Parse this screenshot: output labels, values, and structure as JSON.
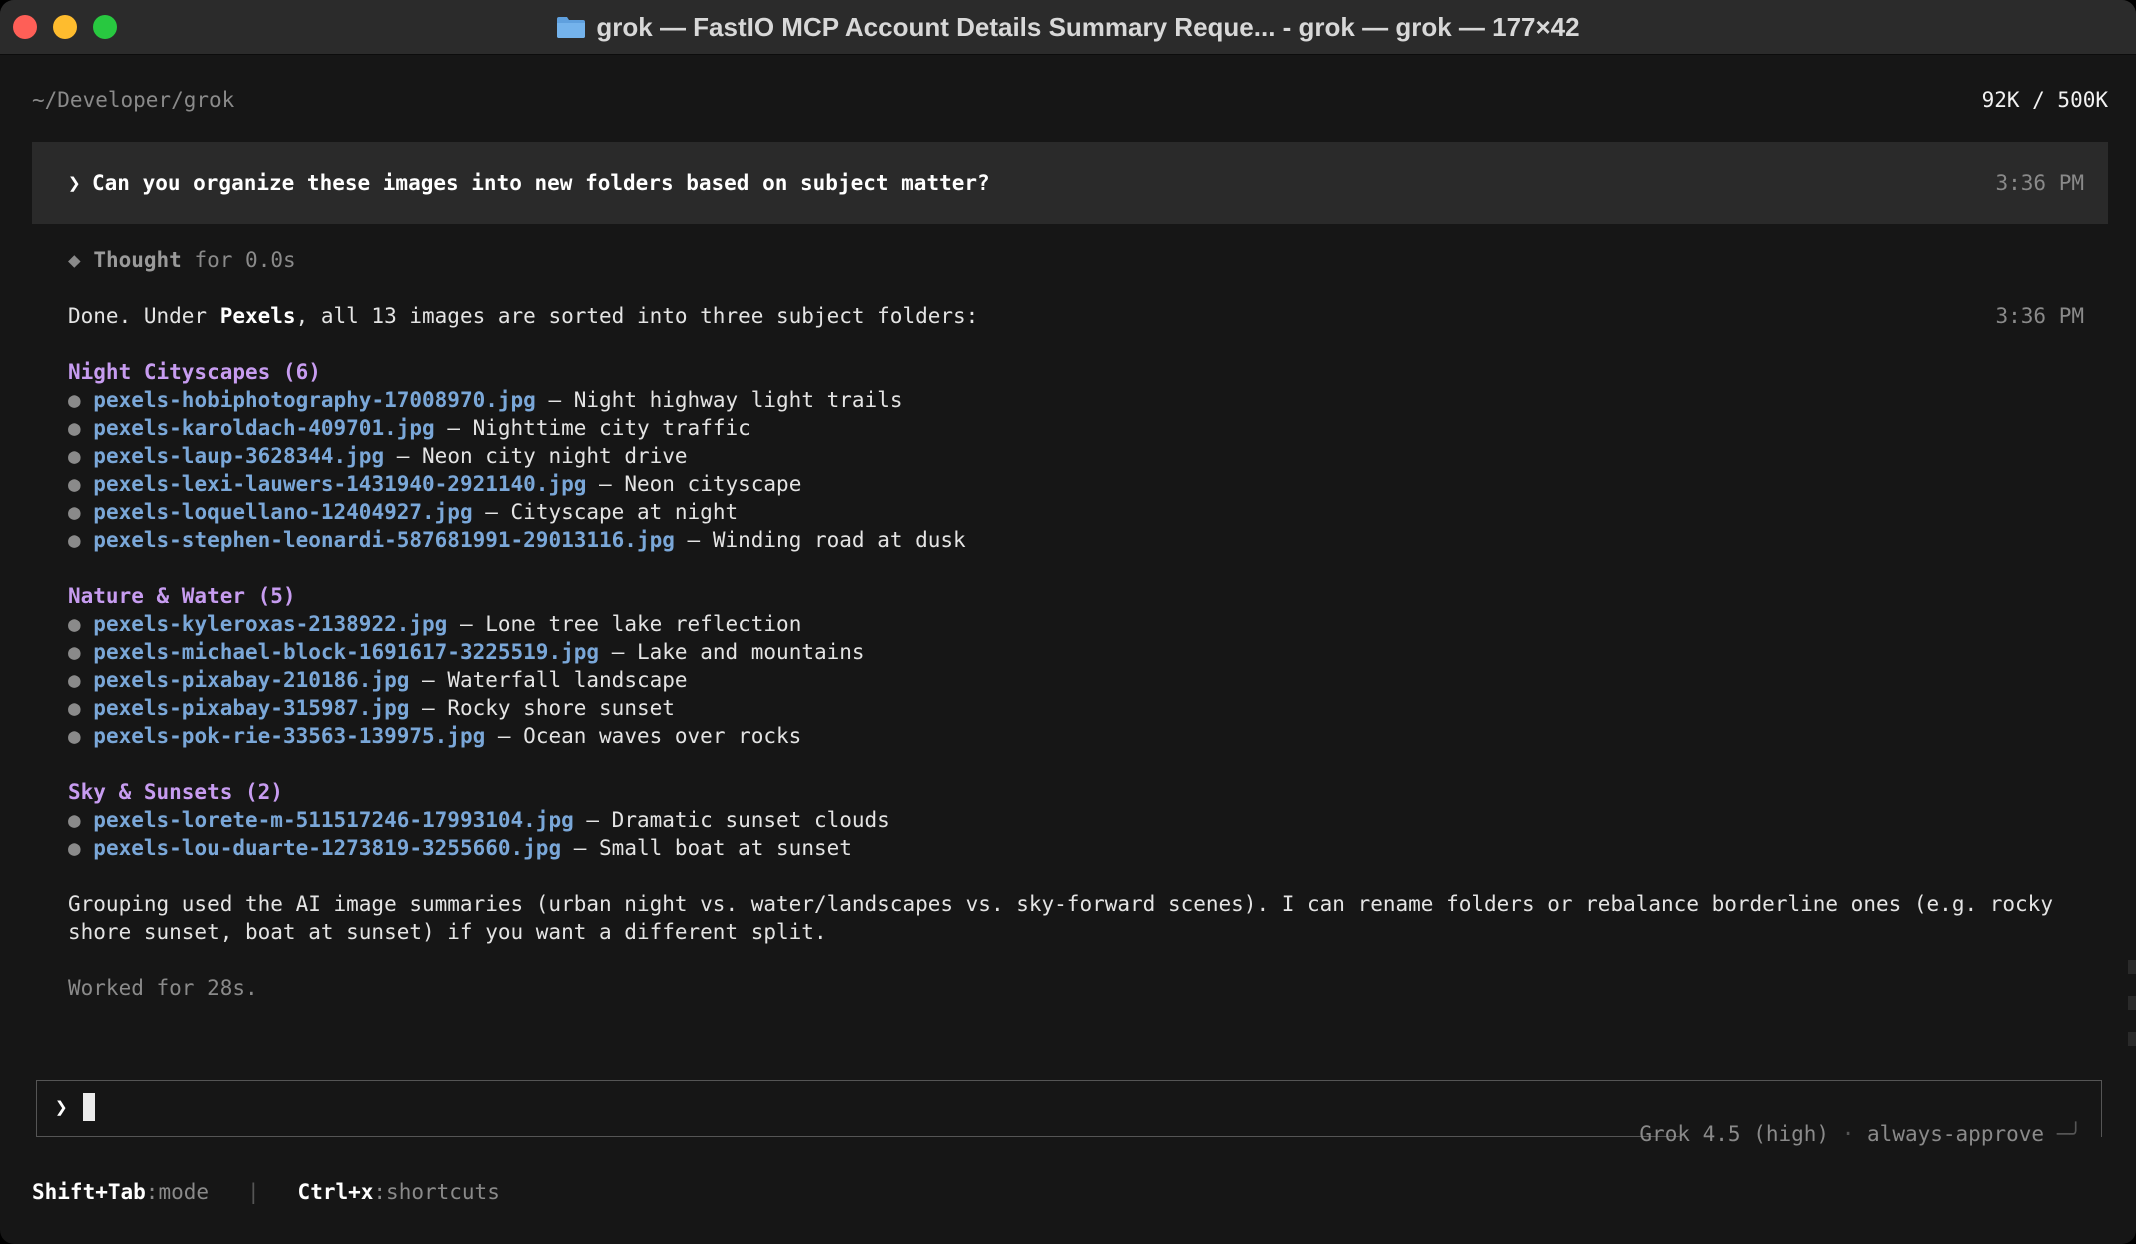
{
  "window": {
    "title": "grok — FastIO MCP Account Details Summary Reque... - grok — grok — 177×42",
    "folder_icon": "folder-icon"
  },
  "header": {
    "cwd": "~/Developer/grok",
    "tokens": "92K / 500K"
  },
  "user_message": {
    "prompt": "❯",
    "text": "Can you organize these images into new folders based on subject matter?",
    "time": "3:36 PM"
  },
  "response": {
    "thought_icon": "◆",
    "thought_label": "Thought",
    "thought_duration": "for 0.0s",
    "intro_pre": "Done. Under ",
    "intro_bold": "Pexels",
    "intro_post": ", all 13 images are sorted into three subject folders:",
    "time": "3:36 PM",
    "groups": [
      {
        "title": "Night Cityscapes (6)",
        "items": [
          {
            "file": "pexels-hobiphotography-17008970.jpg",
            "desc": "– Night highway light trails"
          },
          {
            "file": "pexels-karoldach-409701.jpg",
            "desc": "– Nighttime city traffic"
          },
          {
            "file": "pexels-laup-3628344.jpg",
            "desc": "– Neon city night drive"
          },
          {
            "file": "pexels-lexi-lauwers-1431940-2921140.jpg",
            "desc": "– Neon cityscape"
          },
          {
            "file": "pexels-loquellano-12404927.jpg",
            "desc": "– Cityscape at night"
          },
          {
            "file": "pexels-stephen-leonardi-587681991-29013116.jpg",
            "desc": "– Winding road at dusk"
          }
        ]
      },
      {
        "title": "Nature & Water (5)",
        "items": [
          {
            "file": "pexels-kyleroxas-2138922.jpg",
            "desc": "– Lone tree lake reflection"
          },
          {
            "file": "pexels-michael-block-1691617-3225519.jpg",
            "desc": "– Lake and mountains"
          },
          {
            "file": "pexels-pixabay-210186.jpg",
            "desc": "– Waterfall landscape"
          },
          {
            "file": "pexels-pixabay-315987.jpg",
            "desc": "– Rocky shore sunset"
          },
          {
            "file": "pexels-pok-rie-33563-139975.jpg",
            "desc": "– Ocean waves over rocks"
          }
        ]
      },
      {
        "title": "Sky & Sunsets (2)",
        "items": [
          {
            "file": "pexels-lorete-m-511517246-17993104.jpg",
            "desc": "– Dramatic sunset clouds"
          },
          {
            "file": "pexels-lou-duarte-1273819-3255660.jpg",
            "desc": "– Small boat at sunset"
          }
        ]
      }
    ],
    "summary_line1": "Grouping used the AI image summaries (urban night vs. water/landscapes vs. sky-forward scenes). I can rename folders or rebalance borderline ones (e.g. rocky",
    "summary_line2": "shore sunset, boat at sunset) if you want a different split.",
    "worked": "Worked for 28s."
  },
  "input": {
    "prompt": "❯",
    "model": "Grok 4.5 (high)",
    "separator": "·",
    "approval": "always-approve",
    "corner": "─╯"
  },
  "footer": {
    "mode_key": "Shift+Tab",
    "mode_label": ":mode",
    "pipe": "|",
    "shortcuts_key": "Ctrl+x",
    "shortcuts_label": ":shortcuts"
  },
  "colors": {
    "heading": "#c79cf0",
    "file_link": "#7aa7d8",
    "background": "#161616",
    "user_message_bg": "#2a2a2a"
  }
}
